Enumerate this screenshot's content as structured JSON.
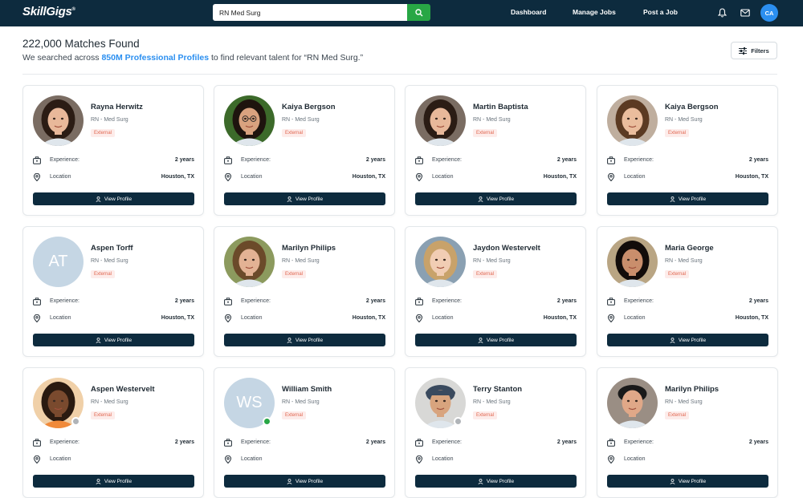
{
  "nav": {
    "logo": "SkillGigs",
    "logo_mark": "®",
    "search_value": "RN Med Surg",
    "links": [
      "Dashboard",
      "Manage Jobs",
      "Post a Job"
    ],
    "user_initials": "CA"
  },
  "header": {
    "title": "222,000 Matches Found",
    "sub_prefix": "We searched across ",
    "sub_highlight": "850M Professional Profiles",
    "sub_suffix": " to find relevant talent for “RN Med Surg.”",
    "filters_label": "Filters"
  },
  "card_labels": {
    "experience": "Experience:",
    "location": "Location",
    "view_profile": "View Profile"
  },
  "cards": [
    {
      "name": "Rayna Herwitz",
      "role": "RN - Med Surg",
      "tag": "External",
      "experience": "2 years",
      "location": "Houston, TX",
      "photo": "woman-dark-hair",
      "status": null
    },
    {
      "name": "Kaiya Bergson",
      "role": "RN - Med Surg",
      "tag": "External",
      "experience": "2 years",
      "location": "Houston, TX",
      "photo": "woman-glasses",
      "status": null
    },
    {
      "name": "Martin Baptista",
      "role": "RN - Med Surg",
      "tag": "External",
      "experience": "2 years",
      "location": "Houston, TX",
      "photo": "woman-dark-hair",
      "status": null
    },
    {
      "name": "Kaiya Bergson",
      "role": "RN - Med Surg",
      "tag": "External",
      "experience": "2 years",
      "location": "Houston, TX",
      "photo": "woman-brown-hair",
      "status": null
    },
    {
      "name": "Aspen Torff",
      "role": "RN - Med Surg",
      "tag": "External",
      "experience": "2 years",
      "location": "Houston, TX",
      "initials": "AT",
      "status": null
    },
    {
      "name": "Marilyn Philips",
      "role": "RN - Med Surg",
      "tag": "External",
      "experience": "2 years",
      "location": "Houston, TX",
      "photo": "woman-outdoor",
      "status": null
    },
    {
      "name": "Jaydon Westervelt",
      "role": "RN - Med Surg",
      "tag": "External",
      "experience": "2 years",
      "location": "Houston, TX",
      "photo": "child-blonde",
      "status": null
    },
    {
      "name": "Maria George",
      "role": "RN - Med Surg",
      "tag": "External",
      "experience": "2 years",
      "location": "Houston, TX",
      "photo": "woman-black-hair",
      "status": null
    },
    {
      "name": "Aspen Westervelt",
      "role": "RN - Med Surg",
      "tag": "External",
      "experience": "2 years",
      "location": "",
      "photo": "woman-curly",
      "status": "offline"
    },
    {
      "name": "William Smith",
      "role": "RN - Med Surg",
      "tag": "External",
      "experience": "2 years",
      "location": "",
      "initials": "WS",
      "status": "online"
    },
    {
      "name": "Terry Stanton",
      "role": "RN - Med Surg",
      "tag": "External",
      "experience": "2 years",
      "location": "",
      "photo": "man-cap",
      "status": "offline"
    },
    {
      "name": "Marilyn Philips",
      "role": "RN - Med Surg",
      "tag": "External",
      "experience": "2 years",
      "location": "",
      "photo": "woman-beanie",
      "status": null
    }
  ],
  "colors": {
    "navy": "#0d2b3e",
    "accent": "#2b8ff0",
    "green": "#28a745",
    "tag": "#e0664f",
    "offline": "#b0b4b8"
  }
}
